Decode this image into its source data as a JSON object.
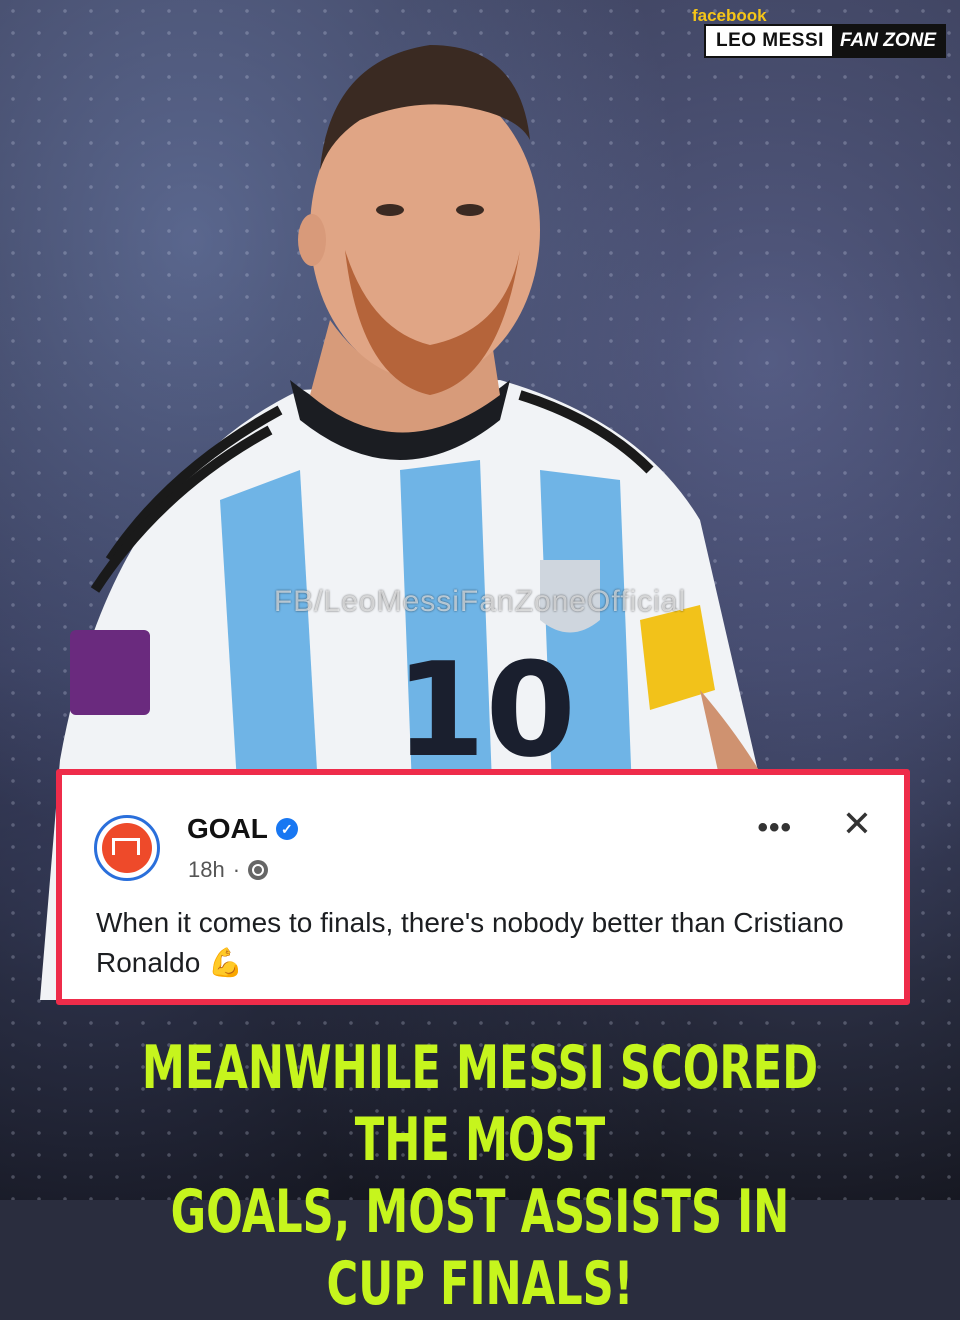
{
  "brand": {
    "platform": "facebook",
    "name": "LEO MESSI",
    "zone": "FAN ZONE"
  },
  "watermark": "FB/LeoMessiFanZoneOfficial",
  "post": {
    "account": "GOAL",
    "time": "18h",
    "separator": "·",
    "more": "•••",
    "close": "✕",
    "text": "When it comes to finals, there's nobody better than Cristiano Ronaldo 💪",
    "icons": [
      "goal-logo-icon",
      "verified-badge-icon",
      "globe-icon",
      "more-options-icon",
      "close-icon",
      "flexed-biceps-emoji"
    ]
  },
  "headline": {
    "line1": "MEANWHILE MESSI SCORED THE MOST",
    "line2": "GOALS, MOST ASSISTS IN CUP FINALS!"
  },
  "colors": {
    "headline": "#c6f51d",
    "card_border": "#ee2c4a",
    "verified": "#1877f2",
    "brand_yellow": "#f5c518",
    "jersey_blue": "#6fb4e6"
  }
}
